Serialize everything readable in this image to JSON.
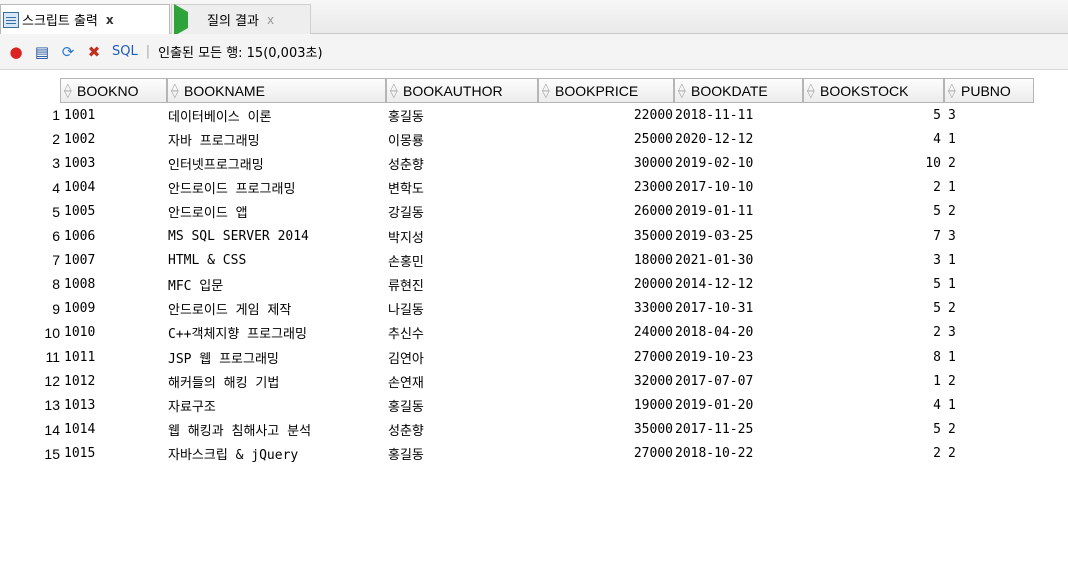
{
  "tabs": [
    {
      "label": "스크립트 출력",
      "close": "x",
      "icon": "script-output-icon"
    },
    {
      "label": "질의 결과",
      "close": "x",
      "icon": "run-statement-icon"
    }
  ],
  "toolbar": {
    "sql_label": "SQL",
    "separator": "|",
    "status": "인출된 모든 행: 15(0,003초)"
  },
  "columns": [
    "BOOKNO",
    "BOOKNAME",
    "BOOKAUTHOR",
    "BOOKPRICE",
    "BOOKDATE",
    "BOOKSTOCK",
    "PUBNO"
  ],
  "rows": [
    {
      "n": "1",
      "bookno": "1001",
      "bookname": "데이터베이스 이론",
      "author": "홍길동",
      "price": "22000",
      "date": "2018-11-11",
      "stock": "5",
      "pubno": "3"
    },
    {
      "n": "2",
      "bookno": "1002",
      "bookname": "자바 프로그래밍",
      "author": "이몽룡",
      "price": "25000",
      "date": "2020-12-12",
      "stock": "4",
      "pubno": "1"
    },
    {
      "n": "3",
      "bookno": "1003",
      "bookname": "인터넷프로그래밍",
      "author": "성춘향",
      "price": "30000",
      "date": "2019-02-10",
      "stock": "10",
      "pubno": "2"
    },
    {
      "n": "4",
      "bookno": "1004",
      "bookname": "안드로이드 프로그래밍",
      "author": "변학도",
      "price": "23000",
      "date": "2017-10-10",
      "stock": "2",
      "pubno": "1"
    },
    {
      "n": "5",
      "bookno": "1005",
      "bookname": "안드로이드 앱",
      "author": "강길동",
      "price": "26000",
      "date": "2019-01-11",
      "stock": "5",
      "pubno": "2"
    },
    {
      "n": "6",
      "bookno": "1006",
      "bookname": "MS SQL SERVER 2014",
      "author": "박지성",
      "price": "35000",
      "date": "2019-03-25",
      "stock": "7",
      "pubno": "3"
    },
    {
      "n": "7",
      "bookno": "1007",
      "bookname": "HTML & CSS",
      "author": "손홍민",
      "price": "18000",
      "date": "2021-01-30",
      "stock": "3",
      "pubno": "1"
    },
    {
      "n": "8",
      "bookno": "1008",
      "bookname": "MFC 입문",
      "author": "류현진",
      "price": "20000",
      "date": "2014-12-12",
      "stock": "5",
      "pubno": "1"
    },
    {
      "n": "9",
      "bookno": "1009",
      "bookname": "안드로이드 게임 제작",
      "author": "나길동",
      "price": "33000",
      "date": "2017-10-31",
      "stock": "5",
      "pubno": "2"
    },
    {
      "n": "10",
      "bookno": "1010",
      "bookname": "C++객체지향 프로그래밍",
      "author": "추신수",
      "price": "24000",
      "date": "2018-04-20",
      "stock": "2",
      "pubno": "3"
    },
    {
      "n": "11",
      "bookno": "1011",
      "bookname": "JSP 웹 프로그래밍",
      "author": "김연아",
      "price": "27000",
      "date": "2019-10-23",
      "stock": "8",
      "pubno": "1"
    },
    {
      "n": "12",
      "bookno": "1012",
      "bookname": "해커들의 해킹 기법",
      "author": "손연재",
      "price": "32000",
      "date": "2017-07-07",
      "stock": "1",
      "pubno": "2"
    },
    {
      "n": "13",
      "bookno": "1013",
      "bookname": "자료구조",
      "author": "홍길동",
      "price": "19000",
      "date": "2019-01-20",
      "stock": "4",
      "pubno": "1"
    },
    {
      "n": "14",
      "bookno": "1014",
      "bookname": "웹 해킹과 침해사고 분석",
      "author": "성춘향",
      "price": "35000",
      "date": "2017-11-25",
      "stock": "5",
      "pubno": "2"
    },
    {
      "n": "15",
      "bookno": "1015",
      "bookname": "자바스크립 & jQuery",
      "author": "홍길동",
      "price": "27000",
      "date": "2018-10-22",
      "stock": "2",
      "pubno": "2"
    }
  ]
}
